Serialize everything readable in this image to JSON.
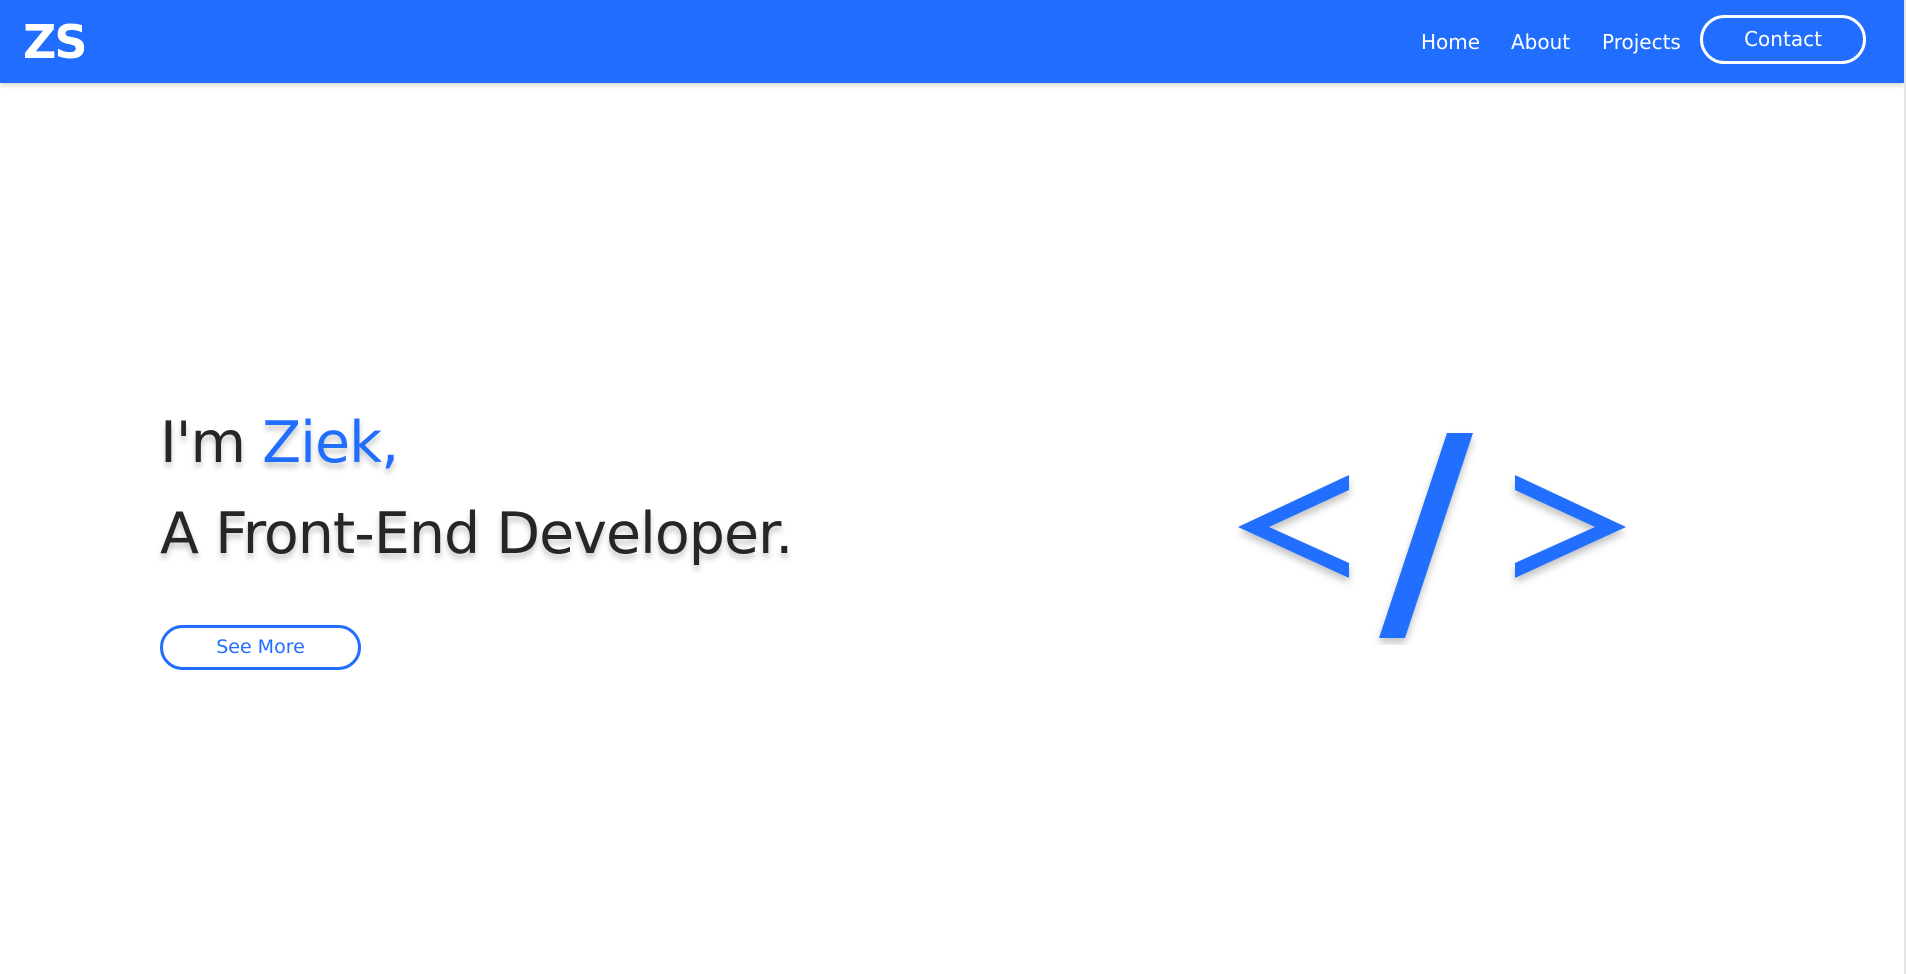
{
  "header": {
    "logo": "ZS",
    "nav": {
      "home": "Home",
      "about": "About",
      "projects": "Projects",
      "contact": "Contact"
    }
  },
  "hero": {
    "greeting_prefix": "I'm ",
    "name": "Ziek,",
    "subtitle": "A Front-End Developer.",
    "button": "See More",
    "icon_name": "code-icon"
  },
  "colors": {
    "accent": "#216efe",
    "text": "#262626",
    "background": "#ffffff"
  }
}
